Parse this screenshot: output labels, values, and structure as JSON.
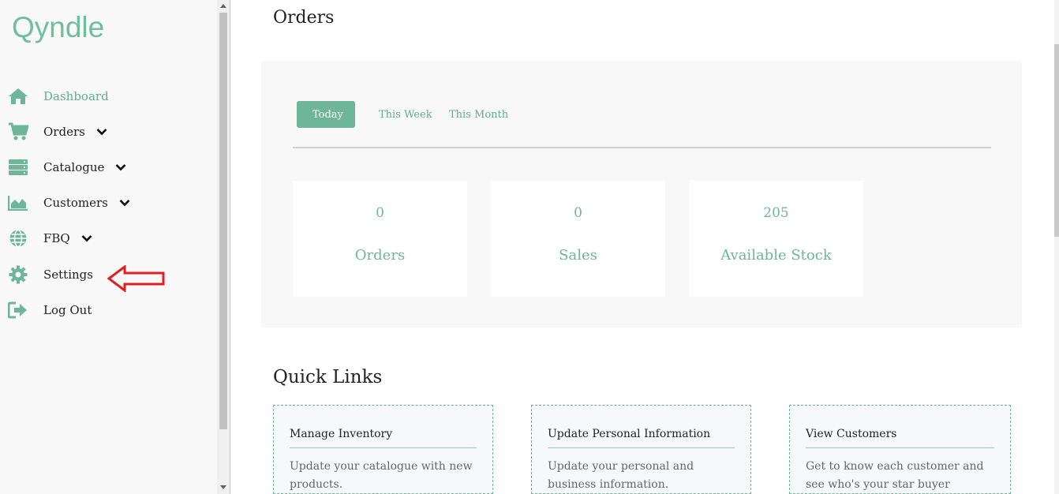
{
  "brand": {
    "logo_text": "Qyndle",
    "accent": "#6fb59a"
  },
  "sidebar": {
    "items": [
      {
        "label": "Dashboard",
        "icon": "home-icon",
        "active": true
      },
      {
        "label": "Orders",
        "icon": "cart-icon",
        "has_children": true
      },
      {
        "label": "Catalogue",
        "icon": "server-icon",
        "has_children": true
      },
      {
        "label": "Customers",
        "icon": "area-chart-icon",
        "has_children": true
      },
      {
        "label": "FBQ",
        "icon": "globe-icon",
        "has_children": true
      },
      {
        "label": "Settings",
        "icon": "gear-icon"
      },
      {
        "label": "Log Out",
        "icon": "sign-out-icon"
      }
    ]
  },
  "main": {
    "title": "Orders",
    "tabs": [
      {
        "label": "Today",
        "active": true
      },
      {
        "label": "This Week"
      },
      {
        "label": "This Month"
      }
    ],
    "stats": [
      {
        "value": "0",
        "label": "Orders"
      },
      {
        "value": "0",
        "label": "Sales"
      },
      {
        "value": "205",
        "label": "Available Stock"
      }
    ]
  },
  "quick_links": {
    "title": "Quick Links",
    "cards": [
      {
        "title": "Manage Inventory",
        "description": "Update your catalogue with new products."
      },
      {
        "title": "Update Personal Information",
        "description": "Update your personal and business information."
      },
      {
        "title": "View Customers",
        "description": "Get to know each customer and see who's your star buyer"
      }
    ]
  },
  "annotation": {
    "arrow_color": "#e02020"
  }
}
